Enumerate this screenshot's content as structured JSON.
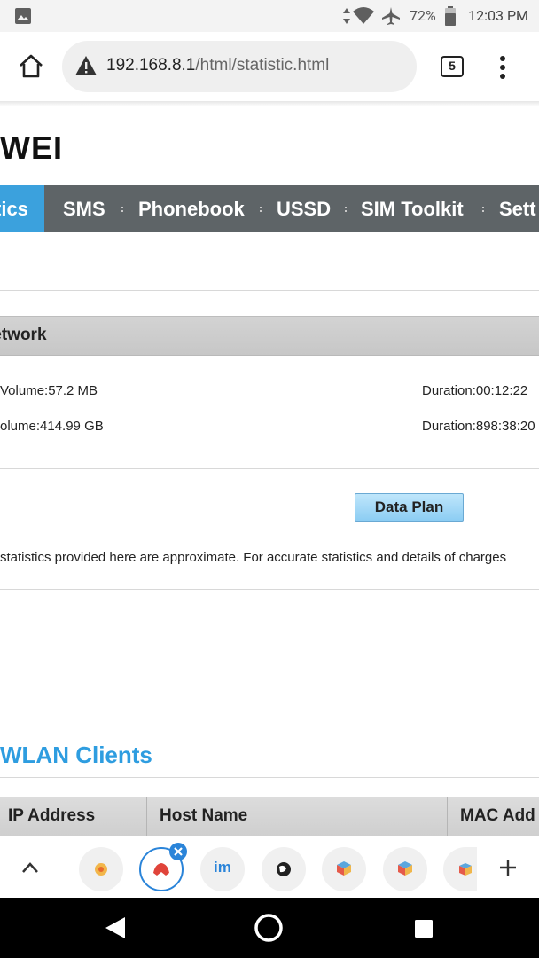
{
  "status_bar": {
    "battery_percent": "72%",
    "time": "12:03 PM"
  },
  "browser": {
    "url_host": "192.168.8.1",
    "url_path": "/html/statistic.html",
    "tab_count": "5"
  },
  "page": {
    "logo_text": "WEI",
    "nav": {
      "items": [
        "tics",
        "SMS",
        "Phonebook",
        "USSD",
        "SIM Toolkit",
        "Sett"
      ],
      "active_index": 0
    },
    "section_title": "letwork",
    "current_volume": "Volume:57.2 MB",
    "current_duration": "Duration:00:12:22",
    "total_volume": "olume:414.99 GB",
    "total_duration": "Duration:898:38:20",
    "data_plan_button": "Data Plan",
    "note": "statistics provided here are approximate. For accurate statistics and details of charges",
    "wlan_title": "WLAN Clients",
    "table_headers": [
      "IP Address",
      "Host Name",
      "MAC Add"
    ]
  },
  "colors": {
    "accent_blue": "#3ba1dd",
    "nav_bg": "#5e6467",
    "wlan_title": "#2e9de0",
    "active_tab_ring": "#2a84d9"
  },
  "icons": {
    "status": [
      "image-icon",
      "data-arrows-icon",
      "wifi-icon",
      "airplane-icon",
      "battery-icon"
    ],
    "toolbar": [
      "home-icon",
      "warning-icon",
      "tabs-icon",
      "more-vert-icon"
    ],
    "tabstrip": [
      "chevron-up-icon",
      "tab-favicon-icon",
      "close-badge-icon",
      "plus-icon"
    ],
    "android_nav": [
      "back-icon",
      "home-circle-icon",
      "recents-icon"
    ]
  }
}
